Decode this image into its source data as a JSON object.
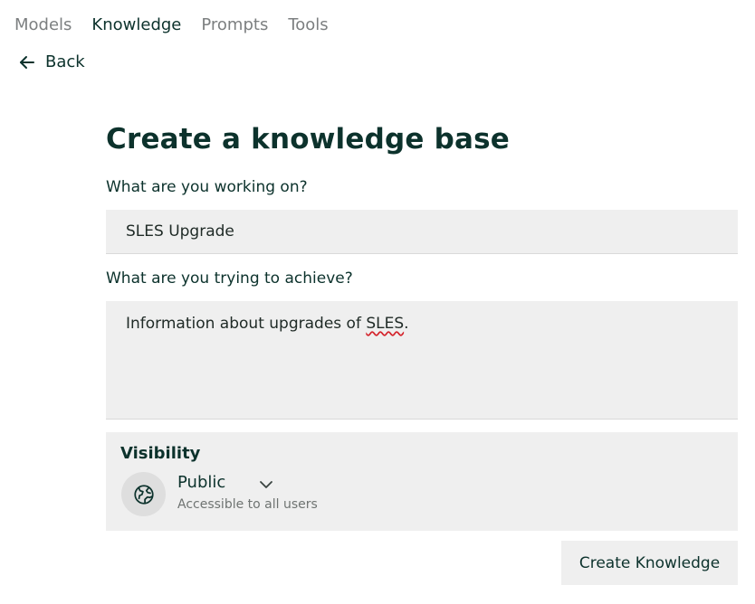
{
  "nav": {
    "tabs": [
      {
        "label": "Models"
      },
      {
        "label": "Knowledge"
      },
      {
        "label": "Prompts"
      },
      {
        "label": "Tools"
      }
    ],
    "active_tab": "Knowledge",
    "back_label": "Back"
  },
  "form": {
    "title": "Create a knowledge base",
    "name_label": "What are you working on?",
    "name_value": "SLES Upgrade",
    "description_label": "What are you trying to achieve?",
    "description_text_before": "Information about upgrades of ",
    "description_misspelled_word": "SLES",
    "description_text_after": ".",
    "visibility": {
      "label": "Visibility",
      "option_label": "Public",
      "option_description": "Accessible to all users",
      "icon": "globe-icon"
    },
    "submit_label": "Create Knowledge"
  },
  "colors": {
    "primary_text": "#0c322c",
    "muted_text": "#7c7f80",
    "field_bg": "#efefef",
    "spellcheck_underline": "#d4232b"
  }
}
